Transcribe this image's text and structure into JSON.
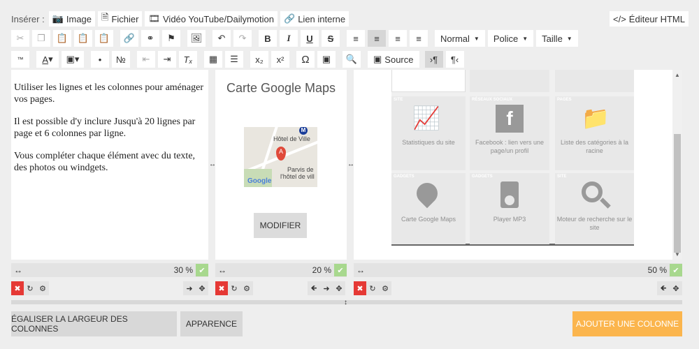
{
  "toolbar1": {
    "insert_label": "Insérer :",
    "image": "Image",
    "file": "Fichier",
    "video": "Vidéo YouTube/Dailymotion",
    "link": "Lien interne",
    "html_editor": "Éditeur HTML"
  },
  "toolbar2": {
    "format": "Normal",
    "font": "Police",
    "size": "Taille"
  },
  "toolbar3": {
    "source": "Source"
  },
  "col1": {
    "p1": "Utiliser les lignes et les colonnes pour aménager vos pages.",
    "p2": "Il est possible d'y inclure Jusqu'à 20 lignes par page et 6 colonnes par ligne.",
    "p3": "Vous compléter chaque élément avec du texte, des photos ou windgets.",
    "width": "30 %"
  },
  "col2": {
    "title": "Carte Google Maps",
    "map_hotel": "Hôtel de Ville",
    "map_parvis": "Parvis de",
    "map_parvis2": "l'hôtel de vill",
    "map_google": "Google",
    "map_pin": "A",
    "map_metro": "M",
    "modify": "MODIFIER",
    "width": "20 %"
  },
  "col3": {
    "width": "50 %",
    "tiles": [
      {
        "tag": "",
        "label": ""
      },
      {
        "tag": "",
        "label": ""
      },
      {
        "tag": "",
        "label": ""
      },
      {
        "tag": "SITE",
        "label": "Statistiques du site"
      },
      {
        "tag": "RÉSEAUX SOCIAUX",
        "label": "Facebook : lien vers une page/un profil"
      },
      {
        "tag": "PAGES",
        "label": "Liste des catégories à la racine"
      },
      {
        "tag": "GADGETS",
        "label": "Carte Google Maps"
      },
      {
        "tag": "GADGETS",
        "label": "Player MP3"
      },
      {
        "tag": "SITE",
        "label": "Moteur de recherche sur le site"
      }
    ]
  },
  "footer": {
    "equalize": "ÉGALISER LA LARGEUR DES COLONNES",
    "appearance": "APPARENCE",
    "add_column": "AJOUTER UNE COLONNE"
  },
  "colors": {
    "accent_orange": "#fbb54d",
    "check_green": "#a8d88e",
    "delete_red": "#e53935"
  }
}
